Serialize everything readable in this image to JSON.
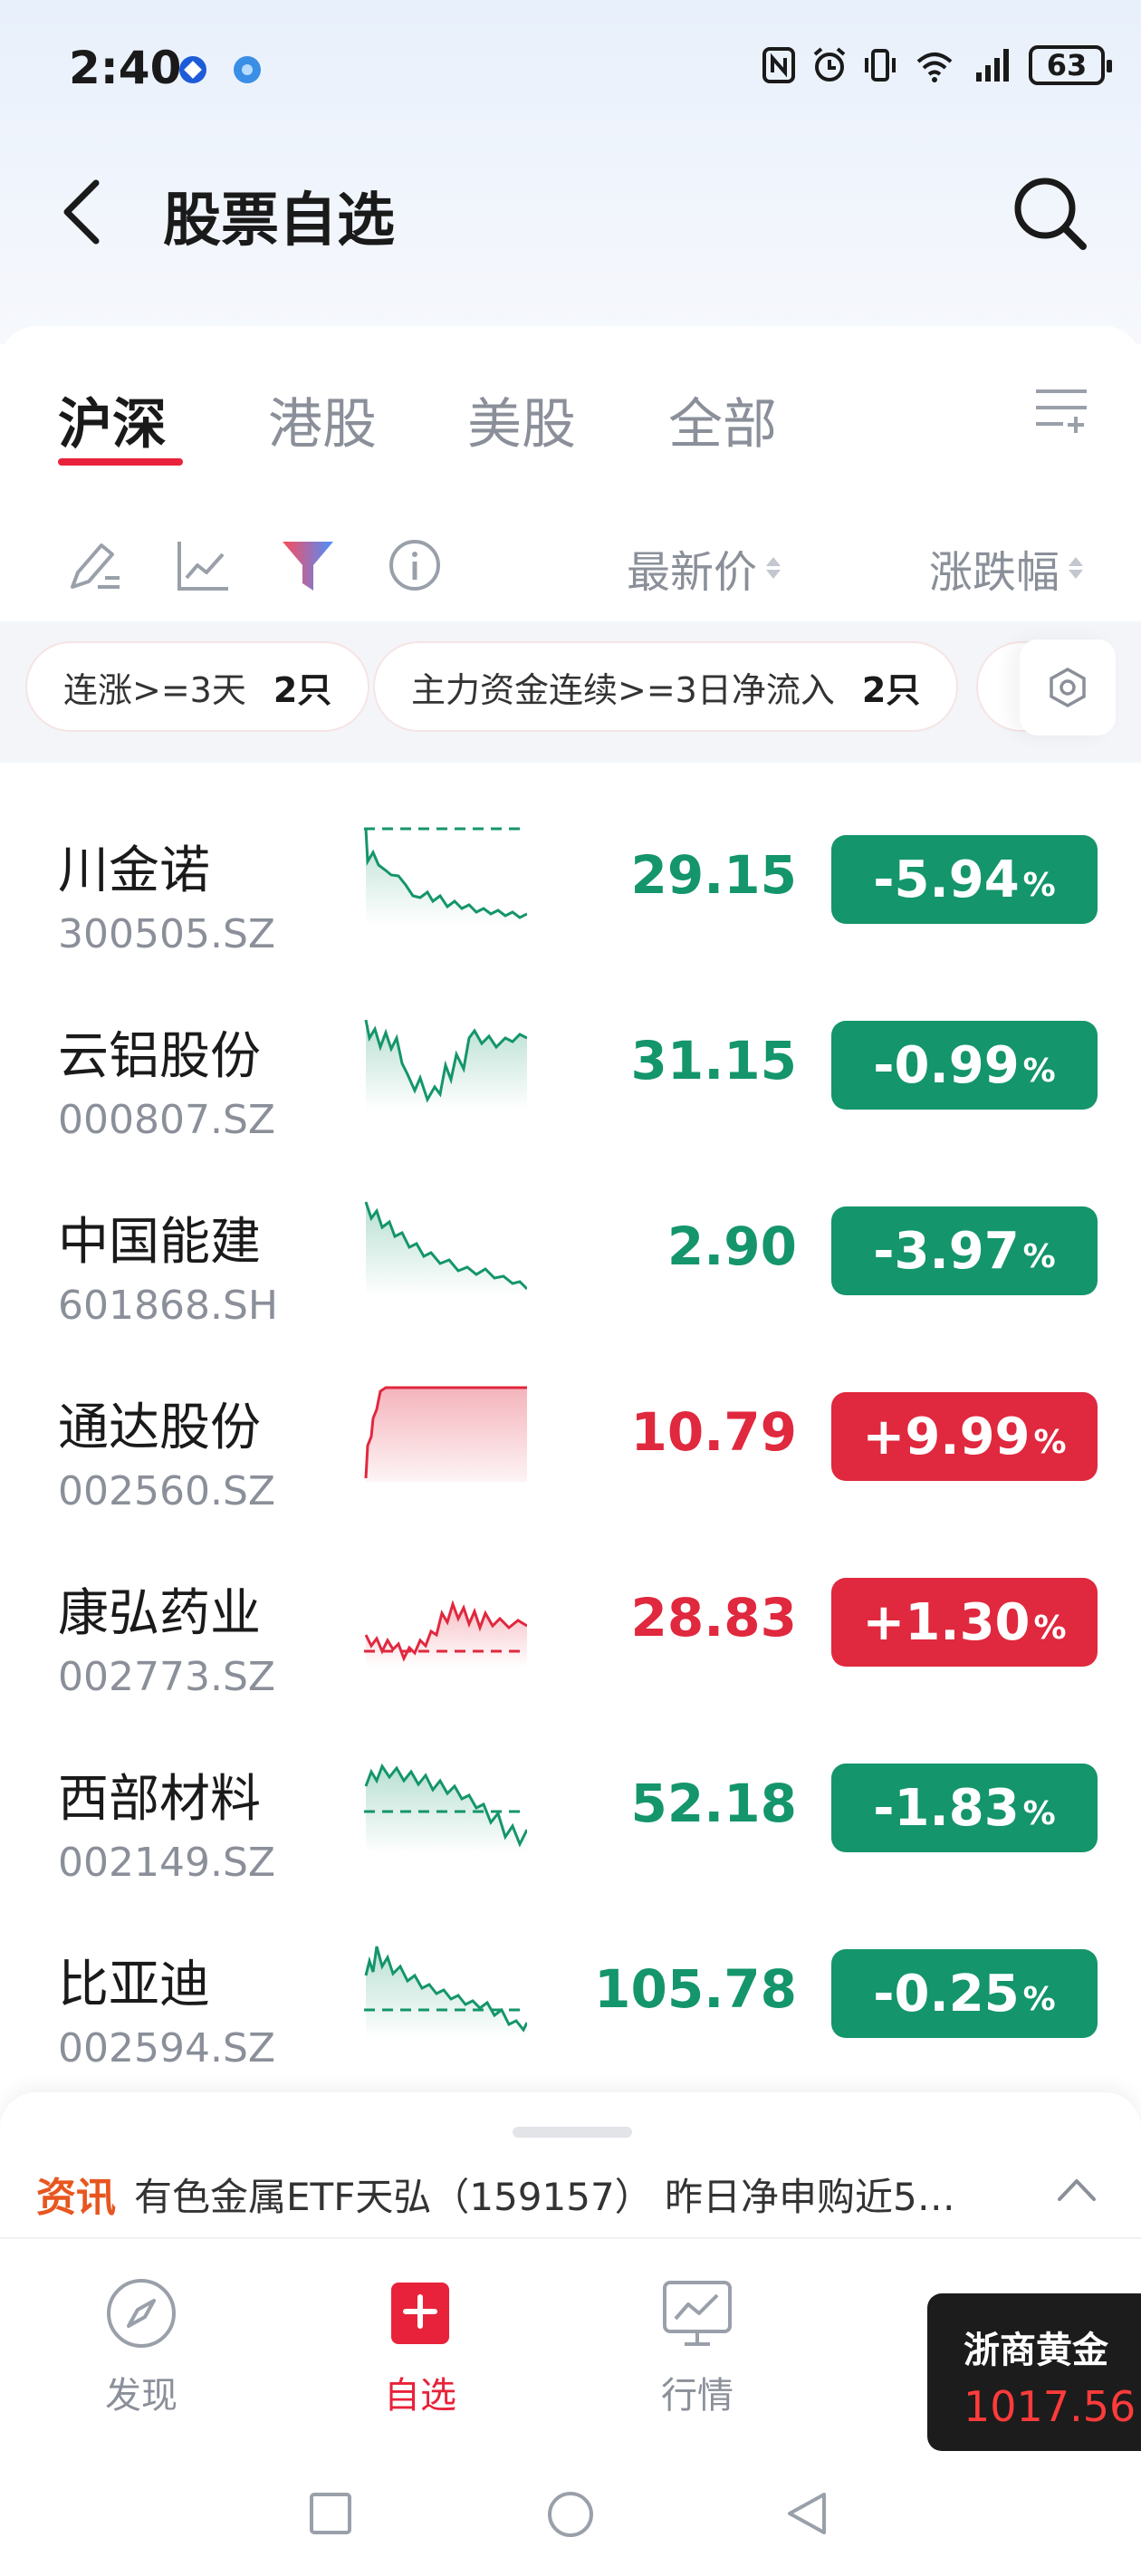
{
  "status_bar": {
    "time": "2:40",
    "battery": "63",
    "icons": [
      "nfc-icon",
      "alarm-icon",
      "vibrate-icon",
      "wifi-icon",
      "signal-icon",
      "battery-icon"
    ]
  },
  "header": {
    "title": "股票自选"
  },
  "market_tabs": [
    {
      "label": "沪深",
      "active": true
    },
    {
      "label": "港股",
      "active": false
    },
    {
      "label": "美股",
      "active": false
    },
    {
      "label": "全部",
      "active": false
    }
  ],
  "columns": {
    "latest_price": "最新价",
    "change_pct": "涨跌幅"
  },
  "filters": [
    {
      "label": "连涨>=3天",
      "count": "2只"
    },
    {
      "label": "主力资金连续>=3日净流入",
      "count": "2只"
    }
  ],
  "stocks": [
    {
      "name": "川金诺",
      "code": "300505.SZ",
      "price": "29.15",
      "change": "-5.94",
      "pct": "%",
      "dir": "down"
    },
    {
      "name": "云铝股份",
      "code": "000807.SZ",
      "price": "31.15",
      "change": "-0.99",
      "pct": "%",
      "dir": "down"
    },
    {
      "name": "中国能建",
      "code": "601868.SH",
      "price": "2.90",
      "change": "-3.97",
      "pct": "%",
      "dir": "down"
    },
    {
      "name": "通达股份",
      "code": "002560.SZ",
      "price": "10.79",
      "change": "+9.99",
      "pct": "%",
      "dir": "up"
    },
    {
      "name": "康弘药业",
      "code": "002773.SZ",
      "price": "28.83",
      "change": "+1.30",
      "pct": "%",
      "dir": "up"
    },
    {
      "name": "西部材料",
      "code": "002149.SZ",
      "price": "52.18",
      "change": "-1.83",
      "pct": "%",
      "dir": "down"
    },
    {
      "name": "比亚迪",
      "code": "002594.SZ",
      "price": "105.78",
      "change": "-0.25",
      "pct": "%",
      "dir": "down"
    }
  ],
  "news": {
    "tag": "资讯",
    "text": "有色金属ETF天弘（159157） 昨日净申购近5…"
  },
  "bottom_nav": [
    {
      "label": "发现",
      "icon": "compass-icon",
      "active": false
    },
    {
      "label": "自选",
      "icon": "add-watchlist-icon",
      "active": true
    },
    {
      "label": "行情",
      "icon": "market-chart-icon",
      "active": false
    }
  ],
  "gold_widget": {
    "name": "浙商黄金",
    "price": "1017.56"
  },
  "colors": {
    "up": "#e0283e",
    "down": "#14956b",
    "accent": "#e8223a"
  }
}
